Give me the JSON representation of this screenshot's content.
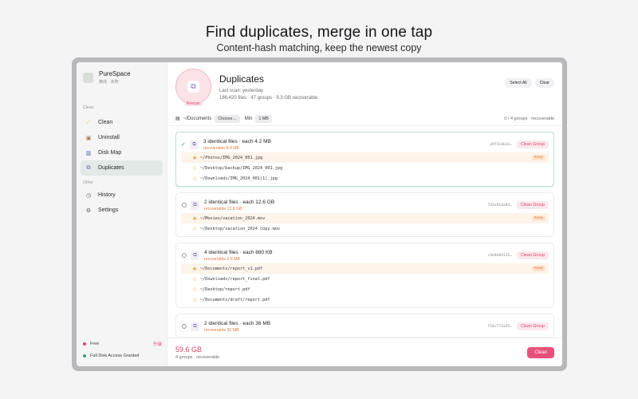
{
  "hero": {
    "title": "Find duplicates, merge in one tap",
    "subtitle": "Content-hash matching, keep the newest copy"
  },
  "sidebar": {
    "app_name": "PureSpace",
    "app_sub": "离线 · 本地",
    "section_clean": "Clean",
    "section_other": "Other",
    "items": [
      {
        "label": "Clean",
        "icon": "broom-icon"
      },
      {
        "label": "Uninstall",
        "icon": "box-icon"
      },
      {
        "label": "Disk Map",
        "icon": "bar-chart-icon"
      },
      {
        "label": "Duplicates",
        "icon": "duplicates-icon",
        "active": true
      }
    ],
    "other_items": [
      {
        "label": "History",
        "icon": "history-icon"
      },
      {
        "label": "Settings",
        "icon": "gear-icon"
      }
    ],
    "plan_label": "Free",
    "upgrade_label": "升级",
    "access_label": "Full Disk Access Granted",
    "colors": {
      "plan_dot": "#e0456c",
      "access_dot": "#3aa37a"
    }
  },
  "header": {
    "title": "Duplicates",
    "rescan": "Rescan",
    "last_scan": "Last scan: yesterday",
    "stats": "186,420 files · 47 groups · 9.3 GB recoverable",
    "select_all": "Select All",
    "clear": "Clear"
  },
  "filter": {
    "path": "~/Documents",
    "choose": "Choose…",
    "min_label": "Min",
    "min_value": "1 MB",
    "summary": "0 / 4 groups · recoverable"
  },
  "groups": [
    {
      "title": "3 identical files · each 4.2 MB",
      "recoverable": "recoverable 8.4 MB",
      "hash": "a9f3c0b2e…",
      "clean_label": "Clean Group",
      "selected": true,
      "files": [
        {
          "path": "~/Photos/IMG_2024_001.jpg",
          "keep": true
        },
        {
          "path": "~/Desktop/backup/IMG_2024_001.jpg",
          "keep": false
        },
        {
          "path": "~/Downloads/IMG_2024_001(1).jpg",
          "keep": false
        }
      ]
    },
    {
      "title": "2 identical files · each 12.6 GB",
      "recoverable": "recoverable 12.6 GB",
      "hash": "7d2e91aa04…",
      "clean_label": "Clean Group",
      "selected": false,
      "files": [
        {
          "path": "~/Movies/vacation_2024.mov",
          "keep": true
        },
        {
          "path": "~/Desktop/vacation_2024 copy.mov",
          "keep": false
        }
      ]
    },
    {
      "title": "4 identical files · each 880 KB",
      "recoverable": "recoverable 2.6 MB",
      "hash": "c4b8e0d115…",
      "clean_label": "Clean Group",
      "selected": false,
      "files": [
        {
          "path": "~/Documents/report_v1.pdf",
          "keep": true
        },
        {
          "path": "~/Downloads/report_final.pdf",
          "keep": false
        },
        {
          "path": "~/Desktop/report.pdf",
          "keep": false
        },
        {
          "path": "~/Documents/draft/report.pdf",
          "keep": false
        }
      ]
    },
    {
      "title": "2 identical files · each 36 MB",
      "recoverable": "recoverable 36 MB",
      "hash": "f10c772a55…",
      "clean_label": "Clean Group",
      "selected": false,
      "files": []
    }
  ],
  "keep_badge": "Keep",
  "footer": {
    "total": "59.6 GB",
    "total_sub": "4 groups · recoverable",
    "clean": "Clean"
  }
}
